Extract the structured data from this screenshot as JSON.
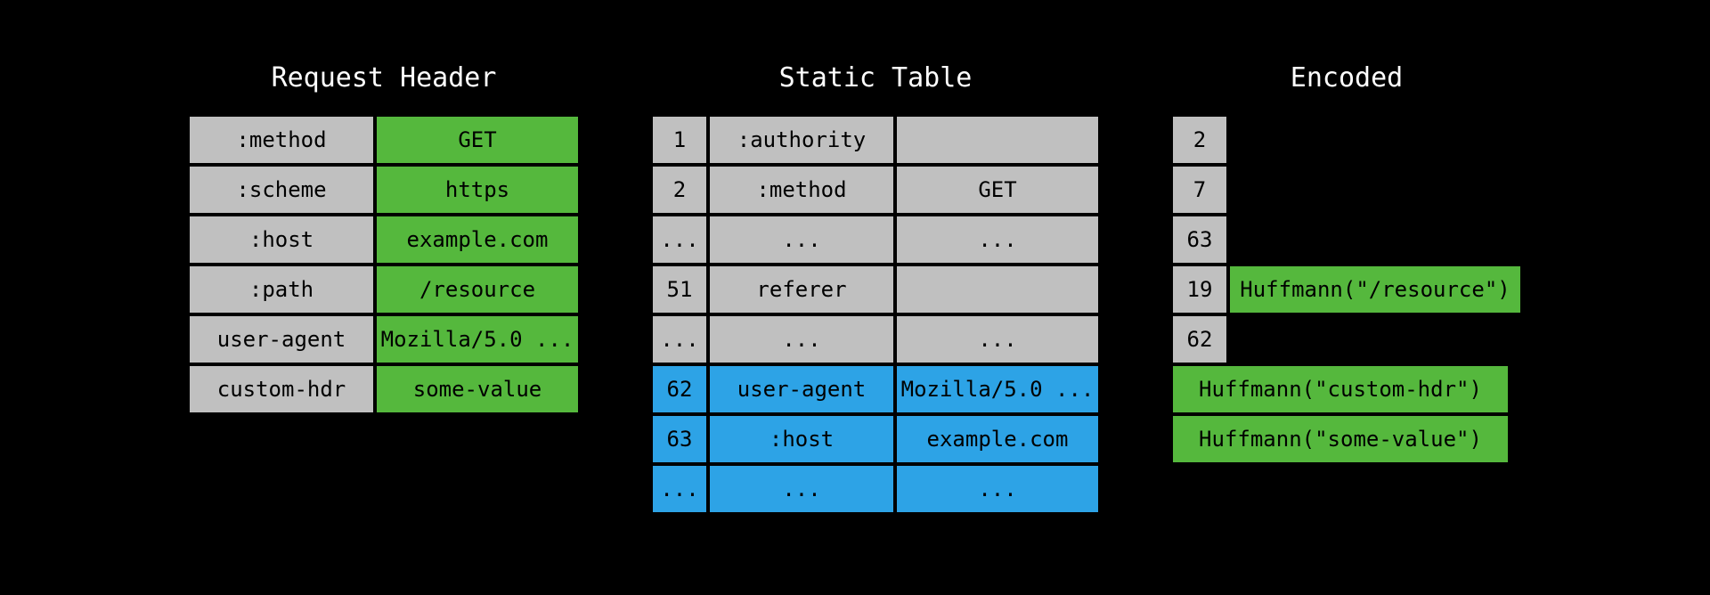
{
  "titles": {
    "request": "Request Header",
    "static": "Static Table",
    "encoded": "Encoded"
  },
  "request": [
    {
      "key": ":method",
      "val": "GET"
    },
    {
      "key": ":scheme",
      "val": "https"
    },
    {
      "key": ":host",
      "val": "example.com"
    },
    {
      "key": ":path",
      "val": "/resource"
    },
    {
      "key": "user-agent",
      "val": "Mozilla/5.0 ..."
    },
    {
      "key": "custom-hdr",
      "val": "some-value"
    }
  ],
  "static": [
    {
      "idx": "1",
      "key": ":authority",
      "val": ""
    },
    {
      "idx": "2",
      "key": ":method",
      "val": "GET"
    },
    {
      "idx": "...",
      "key": "...",
      "val": "..."
    },
    {
      "idx": "51",
      "key": "referer",
      "val": ""
    },
    {
      "idx": "...",
      "key": "...",
      "val": "..."
    }
  ],
  "dynamic": [
    {
      "idx": "62",
      "key": "user-agent",
      "val": "Mozilla/5.0 ..."
    },
    {
      "idx": "63",
      "key": ":host",
      "val": "example.com"
    },
    {
      "idx": "...",
      "key": "...",
      "val": "..."
    }
  ],
  "encoded": [
    {
      "idx": "2",
      "val": null
    },
    {
      "idx": "7",
      "val": null
    },
    {
      "idx": "63",
      "val": null
    },
    {
      "idx": "19",
      "val": "Huffmann(\"/resource\")"
    },
    {
      "idx": "62",
      "val": null
    },
    {
      "idx": null,
      "val": "Huffmann(\"custom-hdr\")"
    },
    {
      "idx": null,
      "val": "Huffmann(\"some-value\")"
    }
  ]
}
